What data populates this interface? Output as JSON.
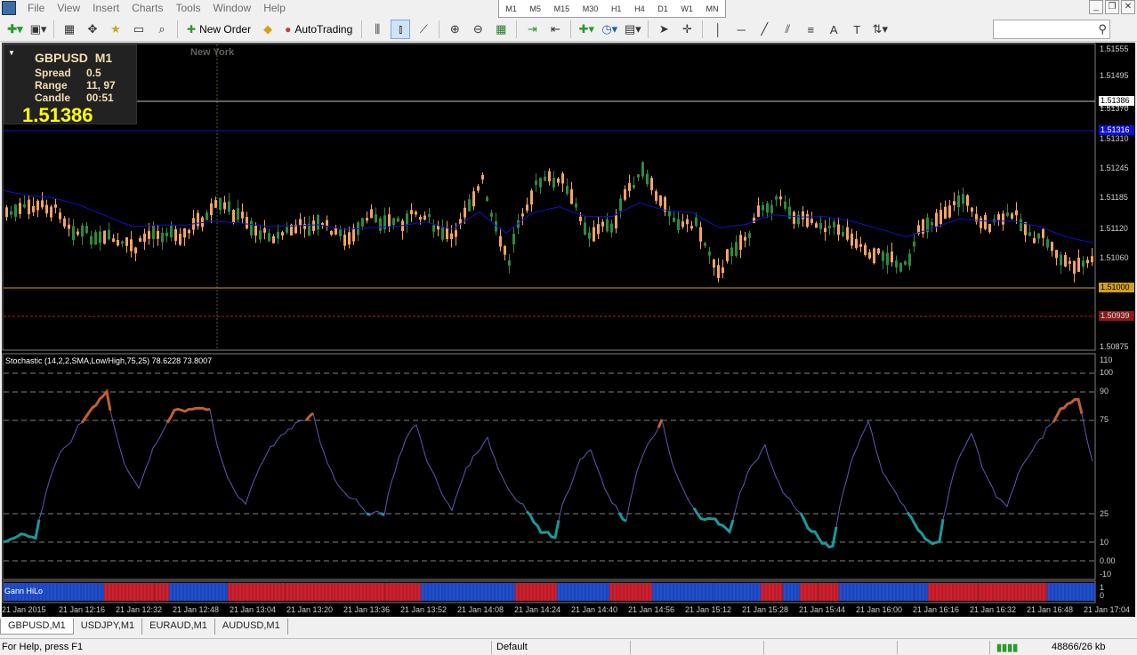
{
  "menu": [
    "File",
    "View",
    "Insert",
    "Charts",
    "Tools",
    "Window",
    "Help"
  ],
  "timeframes": [
    "M1",
    "M5",
    "M15",
    "M30",
    "H1",
    "H4",
    "D1",
    "W1",
    "MN"
  ],
  "toolbar": {
    "new_order": "New Order",
    "autotrading": "AutoTrading"
  },
  "infobox": {
    "symbol": "GBPUSD",
    "tf": "M1",
    "spread_label": "Spread",
    "spread": "0.5",
    "range_label": "Range",
    "range": "11, 97",
    "candle_label": "Candle",
    "candle": "00:51",
    "price": "1.51386"
  },
  "session_label": "New York",
  "price_axis": [
    "1.51555",
    "1.51495",
    "1.51435",
    "1.51370",
    "1.51310",
    "1.51245",
    "1.51185",
    "1.51120",
    "1.51060",
    "1.50995",
    "1.50875"
  ],
  "price_boxes": {
    "bid": "1.51386",
    "blue": "1.51316",
    "orange": "1.51000",
    "red": "1.50939"
  },
  "colors": {
    "bull": "#2e8b3e",
    "bear": "#f4a460",
    "blue_line": "#1010d0",
    "orange_line": "#d4a017",
    "red_line": "#b22222",
    "stoch_hot": "#c06030",
    "stoch_cold": "#1a9a9a",
    "gann_red": "#d02030",
    "gann_blue": "#2050d0"
  },
  "stochastic_title": "Stochastic (14,2,2,SMA,Low/High,75,25) 78.6228 73.8007",
  "stoch_axis": [
    "110",
    "100",
    "90",
    "75",
    "25",
    "10",
    "0.00",
    "-10"
  ],
  "gann_label": "Gann HiLo",
  "gann_axis": [
    "1",
    "0"
  ],
  "time_axis": [
    "21 Jan 2015",
    "21 Jan 12:16",
    "21 Jan 12:32",
    "21 Jan 12:48",
    "21 Jan 13:04",
    "21 Jan 13:20",
    "21 Jan 13:36",
    "21 Jan 13:52",
    "21 Jan 14:08",
    "21 Jan 14:24",
    "21 Jan 14:40",
    "21 Jan 14:56",
    "21 Jan 15:12",
    "21 Jan 15:28",
    "21 Jan 15:44",
    "21 Jan 16:00",
    "21 Jan 16:16",
    "21 Jan 16:32",
    "21 Jan 16:48",
    "21 Jan 17:04"
  ],
  "tabs": [
    "GBPUSD,M1",
    "USDJPY,M1",
    "EURAUD,M1",
    "AUDUSD,M1"
  ],
  "status": {
    "help": "For Help, press F1",
    "profile": "Default",
    "traffic": "48866/26 kb"
  }
}
